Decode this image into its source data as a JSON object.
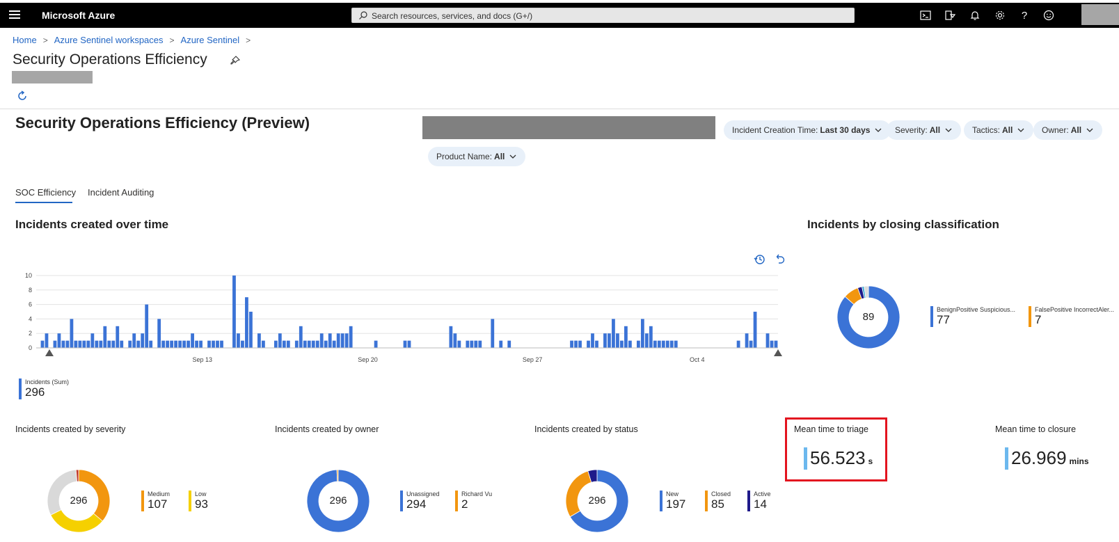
{
  "app": {
    "brand": "Microsoft Azure",
    "search_placeholder": "Search resources, services, and docs (G+/)",
    "top_icons": [
      "cloud-shell-icon",
      "directory-filter-icon",
      "notifications-icon",
      "settings-icon",
      "help-icon",
      "feedback-icon"
    ]
  },
  "breadcrumb": [
    "Home",
    "Azure Sentinel workspaces",
    "Azure Sentinel"
  ],
  "page_title": "Security Operations Efficiency",
  "workbook_title": "Security Operations Efficiency (Preview)",
  "filters": [
    {
      "label": "Incident Creation Time:",
      "value": "Last 30 days"
    },
    {
      "label": "Severity:",
      "value": "All"
    },
    {
      "label": "Tactics:",
      "value": "All"
    },
    {
      "label": "Owner:",
      "value": "All"
    },
    {
      "label": "Product Name:",
      "value": "All"
    }
  ],
  "tabs": [
    "SOC Efficiency",
    "Incident Auditing"
  ],
  "sections": {
    "over_time": "Incidents created over time",
    "closing": "Incidents by closing classification",
    "severity": "Incidents created by severity",
    "owner": "Incidents created by owner",
    "status": "Incidents created by status",
    "triage": "Mean time to triage",
    "closure": "Mean time to closure"
  },
  "chart_data": [
    {
      "type": "bar",
      "title": "Incidents created over time",
      "x_ticks": [
        "Sep 13",
        "Sep 20",
        "Sep 27",
        "Oct 4"
      ],
      "y_ticks": [
        "10",
        "8",
        "6",
        "4",
        "2",
        "0"
      ],
      "ylim": [
        0,
        10
      ],
      "color": "#3b73d6",
      "values": [
        0,
        1,
        2,
        0,
        1,
        2,
        1,
        1,
        4,
        1,
        1,
        1,
        1,
        2,
        1,
        1,
        3,
        1,
        1,
        3,
        1,
        0,
        1,
        2,
        1,
        2,
        6,
        1,
        0,
        4,
        1,
        1,
        1,
        1,
        1,
        1,
        1,
        2,
        1,
        1,
        0,
        1,
        1,
        1,
        1,
        0,
        0,
        10,
        2,
        1,
        7,
        5,
        0,
        2,
        1,
        0,
        0,
        1,
        2,
        1,
        1,
        0,
        1,
        3,
        1,
        1,
        1,
        1,
        2,
        1,
        2,
        1,
        2,
        2,
        2,
        3,
        0,
        0,
        0,
        0,
        0,
        1,
        0,
        0,
        0,
        0,
        0,
        0,
        1,
        1,
        0,
        0,
        0,
        0,
        0,
        0,
        0,
        0,
        0,
        3,
        2,
        1,
        0,
        1,
        1,
        1,
        1,
        0,
        0,
        4,
        0,
        1,
        0,
        1,
        0,
        0,
        0,
        0,
        0,
        0,
        0,
        0,
        0,
        0,
        0,
        0,
        0,
        0,
        1,
        1,
        1,
        0,
        1,
        2,
        1,
        0,
        2,
        2,
        4,
        2,
        1,
        3,
        1,
        0,
        1,
        4,
        2,
        3,
        1,
        1,
        1,
        1,
        1,
        1,
        0,
        0,
        0,
        0,
        0,
        0,
        0,
        0,
        0,
        0,
        0,
        0,
        0,
        0,
        1,
        0,
        2,
        1,
        5,
        0,
        0,
        2,
        1,
        1
      ],
      "legend": {
        "label": "Incidents (Sum)",
        "value": "296"
      }
    },
    {
      "type": "pie",
      "title": "Incidents by closing classification",
      "total": "89",
      "slices": [
        {
          "label": "BenignPositive Suspicious...",
          "value": 77,
          "color": "#3b73d6"
        },
        {
          "label": "FalsePositive IncorrectAler...",
          "value": 7,
          "color": "#f2960f"
        },
        {
          "label": "",
          "value": 2,
          "color": "#1f1a8a"
        },
        {
          "label": "",
          "value": 1,
          "color": "#3fa9d6"
        },
        {
          "label": "",
          "value": 2,
          "color": "#dcdcdc"
        }
      ]
    },
    {
      "type": "pie",
      "title": "Incidents created by severity",
      "total": "296",
      "slices": [
        {
          "label": "Medium",
          "value": 107,
          "color": "#f2960f"
        },
        {
          "label": "Low",
          "value": 93,
          "color": "#f5d000"
        },
        {
          "label": "",
          "value": 92,
          "color": "#d9d9d9"
        },
        {
          "label": "",
          "value": 4,
          "color": "#c0392b"
        }
      ]
    },
    {
      "type": "pie",
      "title": "Incidents created by owner",
      "total": "296",
      "slices": [
        {
          "label": "Unassigned",
          "value": 294,
          "color": "#3b73d6"
        },
        {
          "label": "Richard Vu",
          "value": 2,
          "color": "#f2960f"
        }
      ]
    },
    {
      "type": "pie",
      "title": "Incidents created by status",
      "total": "296",
      "slices": [
        {
          "label": "New",
          "value": 197,
          "color": "#3b73d6"
        },
        {
          "label": "Closed",
          "value": 85,
          "color": "#f2960f"
        },
        {
          "label": "Active",
          "value": 14,
          "color": "#1f1a8a"
        }
      ]
    }
  ],
  "metrics": {
    "triage": {
      "value": "56.523",
      "unit": "s"
    },
    "closure": {
      "value": "26.969",
      "unit": "mins"
    }
  }
}
